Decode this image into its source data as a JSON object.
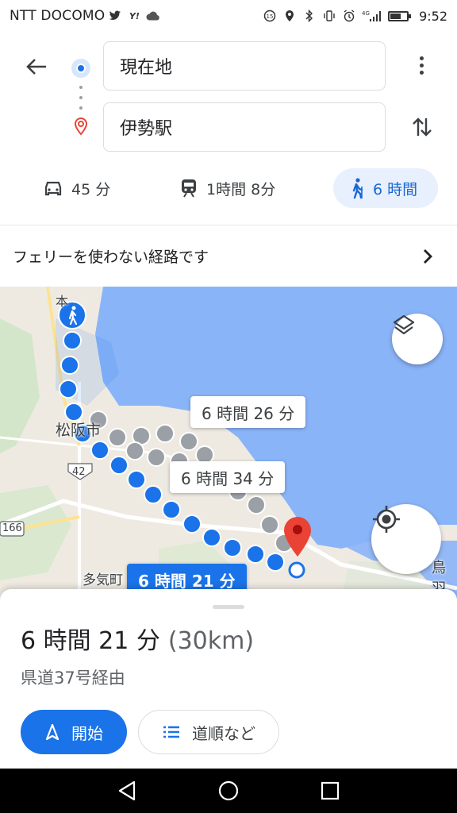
{
  "status_bar": {
    "carrier": "NTT DOCOMO",
    "time": "9:52",
    "network": "4G"
  },
  "directions": {
    "origin": "現在地",
    "destination": "伊勢駅"
  },
  "modes": [
    {
      "name": "car",
      "label": "45 分"
    },
    {
      "name": "transit",
      "label": "1時間 8分"
    },
    {
      "name": "walk",
      "label": "6 時間",
      "selected": true
    }
  ],
  "notice": {
    "text": "フェリーを使わない経路です"
  },
  "map": {
    "labels": {
      "city": "松阪市",
      "route42": "42",
      "route166": "166",
      "town": "多気町",
      "toba": "鳥羽",
      "hon": "本"
    },
    "route_tags": {
      "alt1": "6 時間 26 分",
      "alt2": "6 時間 34 分",
      "primary": "6 時間 21 分"
    }
  },
  "sheet": {
    "duration": "6 時間 21 分",
    "distance": "(30km)",
    "via": "県道37号経由",
    "start_label": "開始",
    "steps_label": "道順など"
  },
  "colors": {
    "accent": "#1a73e8",
    "water": "#8ab4f8",
    "land": "#f1f3f4",
    "destination": "#ea4335"
  }
}
